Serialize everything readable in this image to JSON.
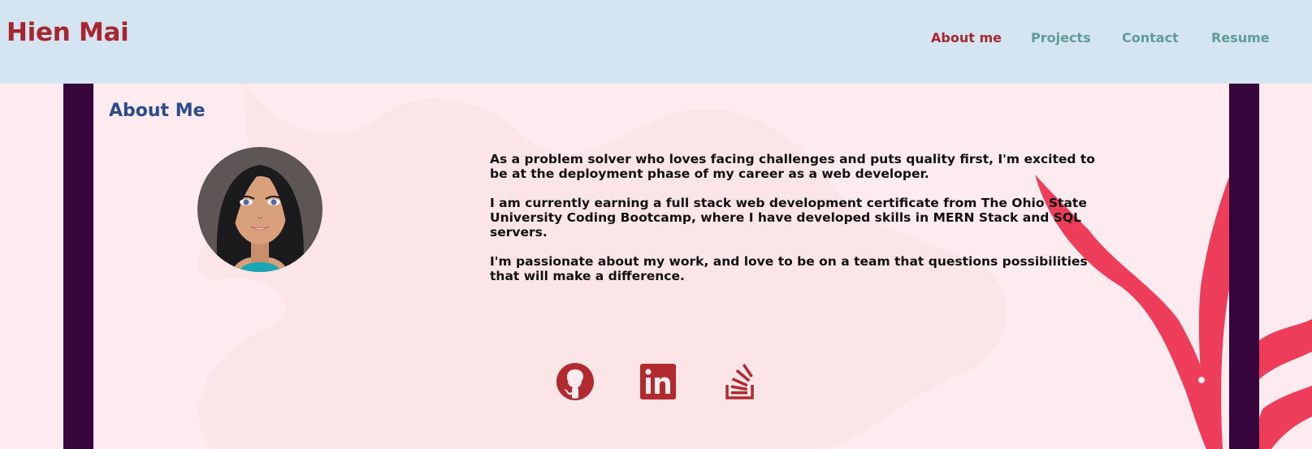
{
  "header": {
    "brand": "Hien Mai",
    "nav": [
      {
        "label": "About me",
        "active": true
      },
      {
        "label": "Projects",
        "active": false
      },
      {
        "label": "Contact",
        "active": false
      },
      {
        "label": "Resume",
        "active": false
      }
    ]
  },
  "about": {
    "title": "About Me",
    "paragraphs": [
      "As a problem solver who loves facing challenges and puts quality first, I'm excited to be at the deployment phase of my career as a web developer.",
      "I am currently earning a full stack web development certificate from The Ohio State University Coding Bootcamp, where I have developed skills in MERN Stack and SQL servers.",
      "I'm passionate about my work, and love to be on a team that questions possibilities that will make a difference."
    ]
  },
  "socials": [
    {
      "icon": "github-icon"
    },
    {
      "icon": "linkedin-icon"
    },
    {
      "icon": "stackoverflow-icon"
    }
  ],
  "colors": {
    "brand": "#a72730",
    "nav_inactive": "#5f9b97",
    "header_bg": "#d4e5f1",
    "page_bg": "#fdebef",
    "side_bar": "#36063d",
    "title": "#2c4b8c",
    "plant": "#ee3d5b"
  }
}
